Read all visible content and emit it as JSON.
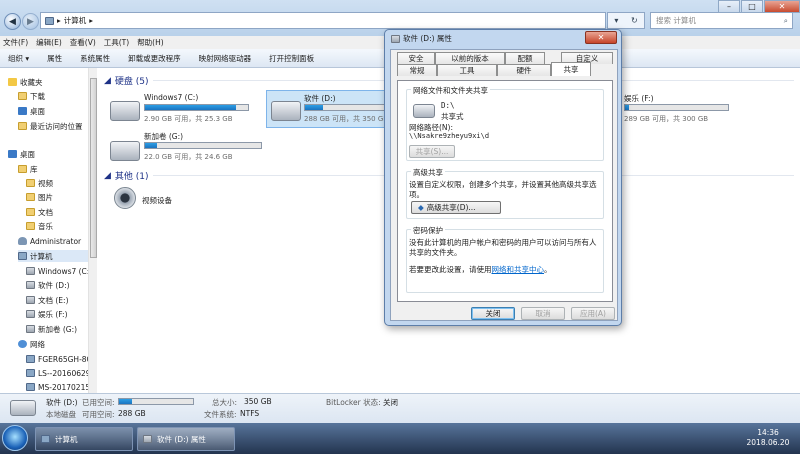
{
  "explorer": {
    "breadcrumb": "计算机",
    "search_placeholder": "搜索 计算机",
    "menu": [
      "文件(F)",
      "编辑(E)",
      "查看(V)",
      "工具(T)",
      "帮助(H)"
    ],
    "toolbar": [
      "组织 ▾",
      "属性",
      "系统属性",
      "卸载或更改程序",
      "映射网络驱动器",
      "打开控制面板"
    ],
    "sidebar": {
      "favorites": "收藏夹",
      "downloads": "下载",
      "desktop_fav": "桌面",
      "recent": "最近访问的位置",
      "desktop": "桌面",
      "libraries": "库",
      "videos": "视频",
      "pictures": "图片",
      "documents": "文档",
      "music": "音乐",
      "admin": "Administrator",
      "computer": "计算机",
      "drive_c": "Windows7 (C:",
      "drive_d": "软件 (D:)",
      "drive_e": "文档 (E:)",
      "drive_f": "娱乐 (F:)",
      "drive_g": "新加卷 (G:)",
      "network": "网络",
      "net1": "FGER65GH-8C",
      "net2": "LS--20160629",
      "net3": "MS-20170215"
    },
    "group_hdd": "硬盘 (5)",
    "group_other": "其他 (1)",
    "drives": {
      "c": {
        "name": "Windows7 (C:)",
        "info": "2.90 GB 可用，共 25.3 GB",
        "used_fraction": 0.885
      },
      "d": {
        "name": "软件 (D:)",
        "info": "288 GB 可用，共 350 GB",
        "used_fraction": 0.177
      },
      "f": {
        "name": "娱乐 (F:)",
        "info": "289 GB 可用，共 300 GB",
        "used_fraction": 0.037
      },
      "g": {
        "name": "新加卷 (G:)",
        "info": "22.0 GB 可用，共 24.6 GB",
        "used_fraction": 0.106
      }
    },
    "other_device": "视频设备",
    "status": {
      "drive": "软件 (D:)",
      "used_label": "已用空间:",
      "used_fraction": 0.177,
      "total_label": "总大小:",
      "total_value": "350 GB",
      "bitlocker_label": "BitLocker 状态:",
      "bitlocker_value": "关闭",
      "type": "本地磁盘",
      "free_label": "可用空间:",
      "free_value": "288 GB",
      "fs_label": "文件系统:",
      "fs_value": "NTFS"
    }
  },
  "dialog": {
    "title": "软件 (D:) 属性",
    "tabs_row1": [
      "安全",
      "以前的版本",
      "配额",
      "自定义"
    ],
    "tabs_row2": [
      "常规",
      "工具",
      "硬件",
      "共享"
    ],
    "section1": "网络文件和文件夹共享",
    "share_drive": "D:\\",
    "share_state": "共享式",
    "network_path_label": "网络路径(N):",
    "network_path": "\\\\Nsakre9zheyu9xi\\d",
    "share_button": "共享(S)...",
    "section2": "高级共享",
    "advanced_desc": "设置自定义权限，创建多个共享，并设置其他高级共享选项。",
    "advanced_button": "高级共享(D)...",
    "section3": "密码保护",
    "password_desc": "没有此计算机的用户帐户和密码的用户可以访问与所有人共享的文件夹。",
    "change_prefix": "若要更改此设置，请使用",
    "change_link": "网络和共享中心",
    "change_suffix": "。",
    "buttons": {
      "close": "关闭",
      "cancel": "取消",
      "apply": "应用(A)"
    }
  },
  "taskbar": {
    "task1": "计算机",
    "task2": "软件 (D:) 属性",
    "time": "14:36",
    "date": "2018.06.20"
  }
}
